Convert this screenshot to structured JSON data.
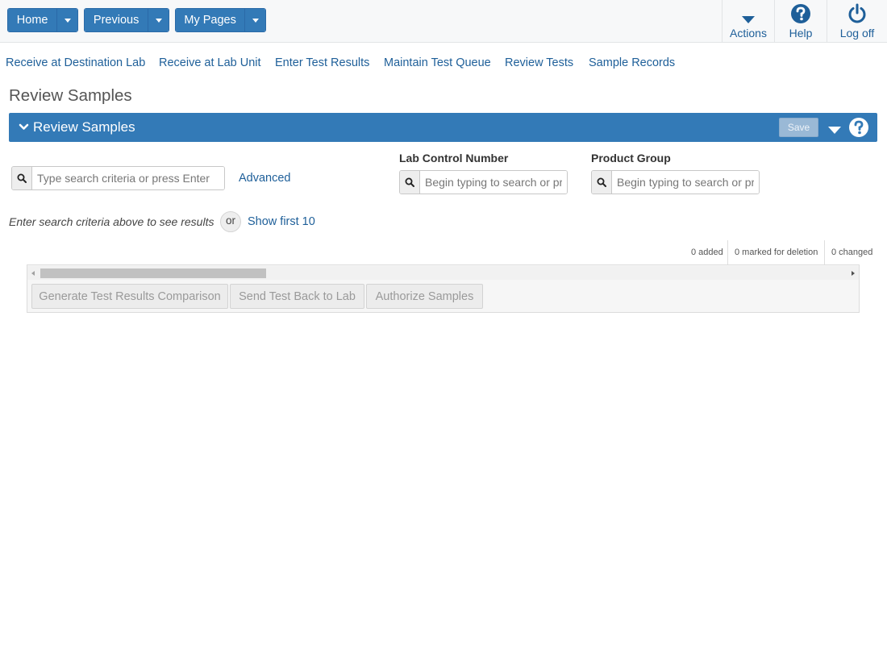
{
  "topbar": {
    "home_label": "Home",
    "previous_label": "Previous",
    "mypages_label": "My Pages",
    "actions_label": "Actions",
    "help_label": "Help",
    "logoff_label": "Log off"
  },
  "nav_links": [
    "Receive at Destination Lab",
    "Receive at Lab Unit",
    "Enter Test Results",
    "Maintain Test Queue",
    "Review Tests",
    "Sample Records"
  ],
  "page": {
    "title": "Review Samples"
  },
  "panel": {
    "title": "Review Samples",
    "save_label": "Save"
  },
  "search": {
    "main_placeholder": "Type search criteria or press Enter",
    "advanced_label": "Advanced",
    "lab_control_label": "Lab Control Number",
    "lab_control_placeholder": "Begin typing to search or press Enter",
    "product_group_label": "Product Group",
    "product_group_placeholder": "Begin typing to search or press Enter",
    "hint": "Enter search criteria above to see results",
    "or_label": "or",
    "show_first_label": "Show first 10"
  },
  "counts": {
    "added": "0 added",
    "deleted": "0 marked for deletion",
    "changed": "0 changed"
  },
  "grid": {
    "scroll_fraction": 0.28,
    "buttons": [
      "Generate Test Results Comparison",
      "Send Test Back to Lab",
      "Authorize Samples"
    ]
  },
  "colors": {
    "primary": "#337ab7",
    "link": "#1e5f99",
    "disabled_text": "#9a9a9a"
  }
}
